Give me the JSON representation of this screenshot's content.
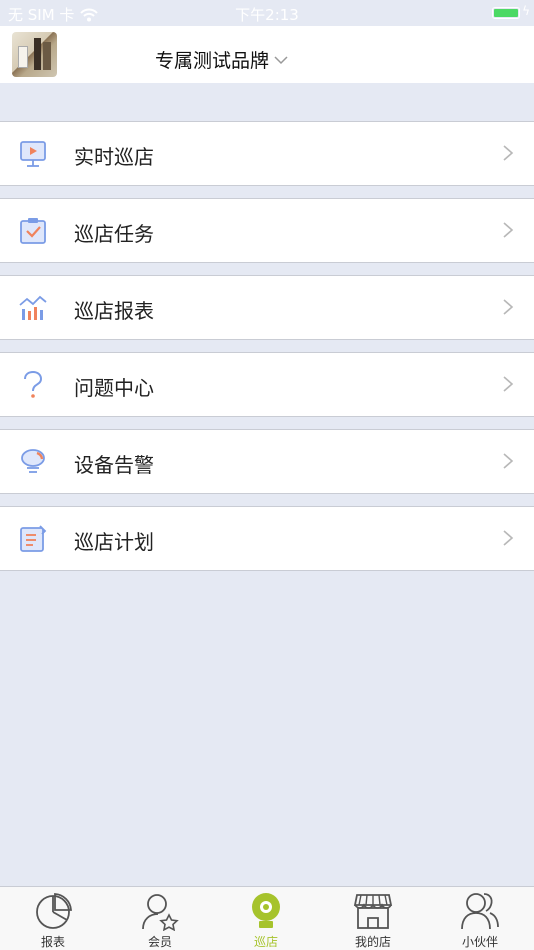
{
  "status_bar": {
    "carrier": "无 SIM 卡",
    "time": "下午2:13"
  },
  "header": {
    "brand_name": "专属测试品牌"
  },
  "menu": [
    {
      "label": "实时巡店",
      "icon": "monitor-play-icon"
    },
    {
      "label": "巡店任务",
      "icon": "clipboard-check-icon"
    },
    {
      "label": "巡店报表",
      "icon": "bar-chart-icon"
    },
    {
      "label": "问题中心",
      "icon": "question-mark-icon"
    },
    {
      "label": "设备告警",
      "icon": "alarm-bell-icon"
    },
    {
      "label": "巡店计划",
      "icon": "plan-notepad-icon"
    }
  ],
  "menu_arrow": ">",
  "tabbar": {
    "tabs": [
      {
        "label": "报表",
        "icon": "pie-chart-icon",
        "active": false
      },
      {
        "label": "会员",
        "icon": "member-star-icon",
        "active": false
      },
      {
        "label": "巡店",
        "icon": "camera-icon",
        "active": true
      },
      {
        "label": "我的店",
        "icon": "store-icon",
        "active": false
      },
      {
        "label": "小伙伴",
        "icon": "partners-icon",
        "active": false
      }
    ]
  },
  "colors": {
    "accent": "#a6c32c",
    "icon_blue": "#7b9ce6",
    "icon_orange": "#f0835c",
    "background": "#e5e9f3"
  }
}
